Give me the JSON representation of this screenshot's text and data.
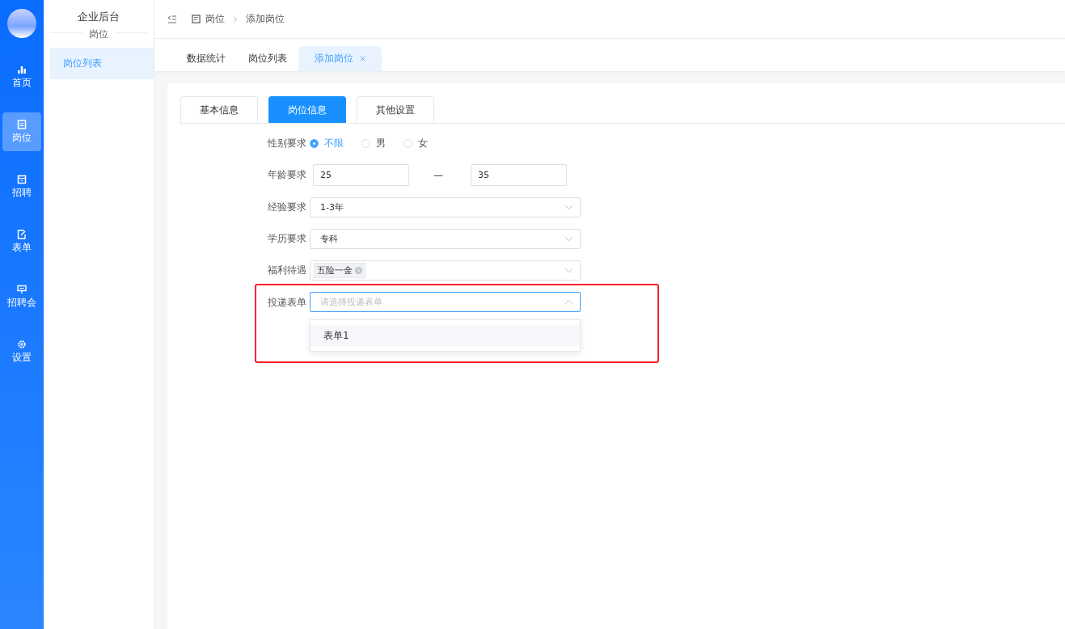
{
  "rail": {
    "items": [
      {
        "label": "首页",
        "selected": false
      },
      {
        "label": "岗位",
        "selected": true
      },
      {
        "label": "招聘",
        "selected": false
      },
      {
        "label": "表单",
        "selected": false
      },
      {
        "label": "招聘会",
        "selected": false
      },
      {
        "label": "设置",
        "selected": false
      }
    ]
  },
  "sidebar": {
    "title": "企业后台",
    "section": "岗位",
    "items": [
      {
        "label": "岗位列表",
        "selected": true
      }
    ]
  },
  "breadcrumb": [
    "岗位",
    "添加岗位"
  ],
  "page_tabs": [
    {
      "label": "数据统计",
      "selected": false,
      "closable": false
    },
    {
      "label": "岗位列表",
      "selected": false,
      "closable": false
    },
    {
      "label": "添加岗位",
      "selected": true,
      "closable": true
    }
  ],
  "form_tabs": [
    {
      "label": "基本信息",
      "selected": false
    },
    {
      "label": "岗位信息",
      "selected": true
    },
    {
      "label": "其他设置",
      "selected": false
    }
  ],
  "form": {
    "gender": {
      "label": "性别要求",
      "options": [
        {
          "label": "不限",
          "selected": true
        },
        {
          "label": "男",
          "selected": false
        },
        {
          "label": "女",
          "selected": false
        }
      ]
    },
    "age": {
      "label": "年龄要求",
      "min": "25",
      "separator": "—",
      "max": "35"
    },
    "experience": {
      "label": "经验要求",
      "value": "1-3年"
    },
    "education": {
      "label": "学历要求",
      "value": "专科"
    },
    "benefits": {
      "label": "福利待遇",
      "tags": [
        "五险一金"
      ]
    },
    "form_select": {
      "label": "投递表单",
      "placeholder": "请选择投递表单",
      "expanded": true,
      "highlighted": true,
      "options": [
        {
          "label": "表单1",
          "hovered": true
        }
      ]
    }
  }
}
